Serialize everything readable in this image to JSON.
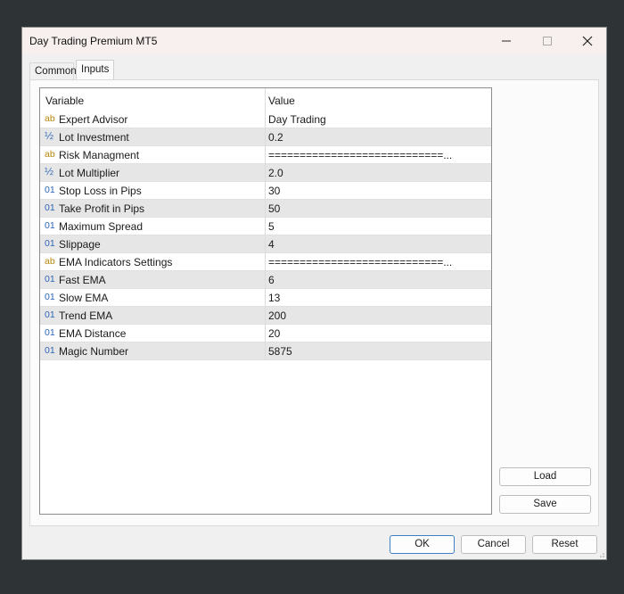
{
  "window": {
    "title": "Day Trading Premium MT5"
  },
  "tabs": [
    {
      "label": "Common"
    },
    {
      "label": "Inputs"
    }
  ],
  "grid": {
    "headers": {
      "variable": "Variable",
      "value": "Value"
    },
    "rows": [
      {
        "type": "ab",
        "name": "Expert Advisor",
        "value": "Day Trading"
      },
      {
        "type": "½",
        "name": "Lot Investment",
        "value": "0.2"
      },
      {
        "type": "ab",
        "name": "Risk Managment",
        "value": "============================..."
      },
      {
        "type": "½",
        "name": "Lot Multiplier",
        "value": "2.0"
      },
      {
        "type": "01",
        "name": "Stop Loss in Pips",
        "value": "30"
      },
      {
        "type": "01",
        "name": "Take Profit in Pips",
        "value": "50"
      },
      {
        "type": "01",
        "name": "Maximum Spread",
        "value": "5"
      },
      {
        "type": "01",
        "name": "Slippage",
        "value": "4"
      },
      {
        "type": "ab",
        "name": "EMA Indicators Settings",
        "value": "============================..."
      },
      {
        "type": "01",
        "name": "Fast EMA",
        "value": "6"
      },
      {
        "type": "01",
        "name": "Slow EMA",
        "value": "13"
      },
      {
        "type": "01",
        "name": "Trend EMA",
        "value": "200"
      },
      {
        "type": "01",
        "name": "EMA Distance",
        "value": "20"
      },
      {
        "type": "01",
        "name": "Magic Number",
        "value": "5875"
      }
    ]
  },
  "buttons": {
    "load": "Load",
    "save": "Save",
    "ok": "OK",
    "cancel": "Cancel",
    "reset": "Reset"
  }
}
